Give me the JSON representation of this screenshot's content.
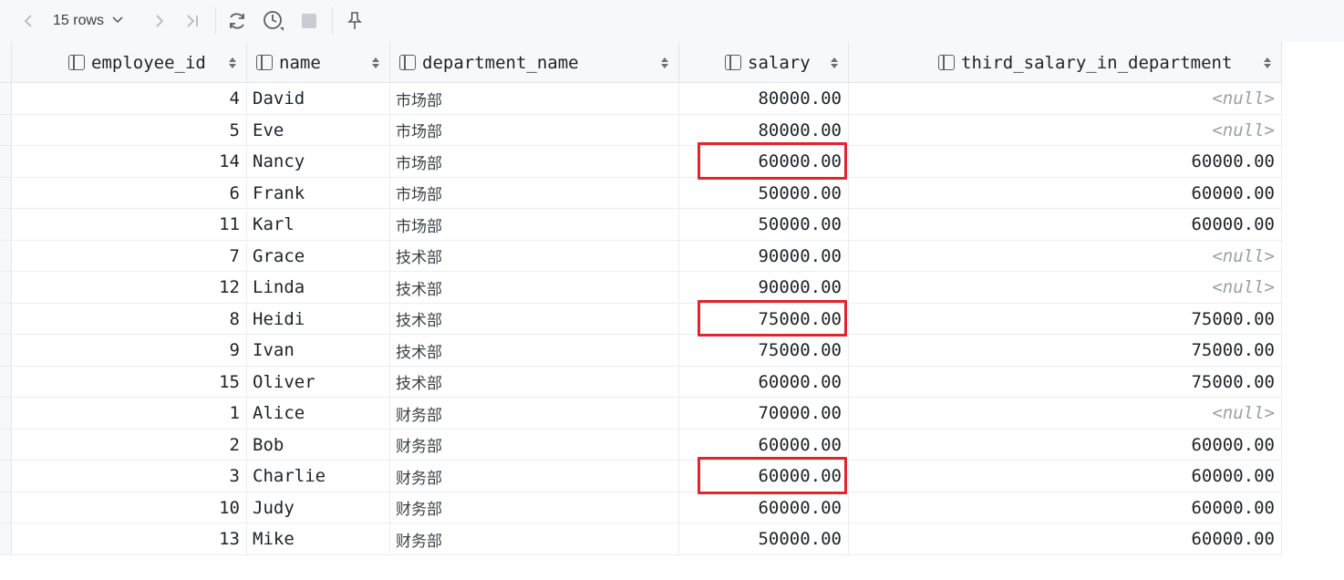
{
  "toolbar": {
    "rows_label": "15 rows"
  },
  "columns": [
    {
      "label": "employee_id"
    },
    {
      "label": "name"
    },
    {
      "label": "department_name"
    },
    {
      "label": "salary"
    },
    {
      "label": "third_salary_in_department"
    }
  ],
  "rows": [
    {
      "employee_id": "4",
      "name": "David",
      "department_name": "市场部",
      "salary": "80000.00",
      "third_salary_in_department": "<null>"
    },
    {
      "employee_id": "5",
      "name": "Eve",
      "department_name": "市场部",
      "salary": "80000.00",
      "third_salary_in_department": "<null>"
    },
    {
      "employee_id": "14",
      "name": "Nancy",
      "department_name": "市场部",
      "salary": "60000.00",
      "third_salary_in_department": "60000.00"
    },
    {
      "employee_id": "6",
      "name": "Frank",
      "department_name": "市场部",
      "salary": "50000.00",
      "third_salary_in_department": "60000.00"
    },
    {
      "employee_id": "11",
      "name": "Karl",
      "department_name": "市场部",
      "salary": "50000.00",
      "third_salary_in_department": "60000.00"
    },
    {
      "employee_id": "7",
      "name": "Grace",
      "department_name": "技术部",
      "salary": "90000.00",
      "third_salary_in_department": "<null>"
    },
    {
      "employee_id": "12",
      "name": "Linda",
      "department_name": "技术部",
      "salary": "90000.00",
      "third_salary_in_department": "<null>"
    },
    {
      "employee_id": "8",
      "name": "Heidi",
      "department_name": "技术部",
      "salary": "75000.00",
      "third_salary_in_department": "75000.00"
    },
    {
      "employee_id": "9",
      "name": "Ivan",
      "department_name": "技术部",
      "salary": "75000.00",
      "third_salary_in_department": "75000.00"
    },
    {
      "employee_id": "15",
      "name": "Oliver",
      "department_name": "技术部",
      "salary": "60000.00",
      "third_salary_in_department": "75000.00"
    },
    {
      "employee_id": "1",
      "name": "Alice",
      "department_name": "财务部",
      "salary": "70000.00",
      "third_salary_in_department": "<null>"
    },
    {
      "employee_id": "2",
      "name": "Bob",
      "department_name": "财务部",
      "salary": "60000.00",
      "third_salary_in_department": "60000.00"
    },
    {
      "employee_id": "3",
      "name": "Charlie",
      "department_name": "财务部",
      "salary": "60000.00",
      "third_salary_in_department": "60000.00"
    },
    {
      "employee_id": "10",
      "name": "Judy",
      "department_name": "财务部",
      "salary": "60000.00",
      "third_salary_in_department": "60000.00"
    },
    {
      "employee_id": "13",
      "name": "Mike",
      "department_name": "财务部",
      "salary": "50000.00",
      "third_salary_in_department": "60000.00"
    }
  ],
  "highlighted_rows": [
    2,
    7,
    12
  ],
  "colors": {
    "highlight": "#e0252b",
    "null_text": "#9aa0a6",
    "toolbar_bg": "#f7f8fa"
  }
}
